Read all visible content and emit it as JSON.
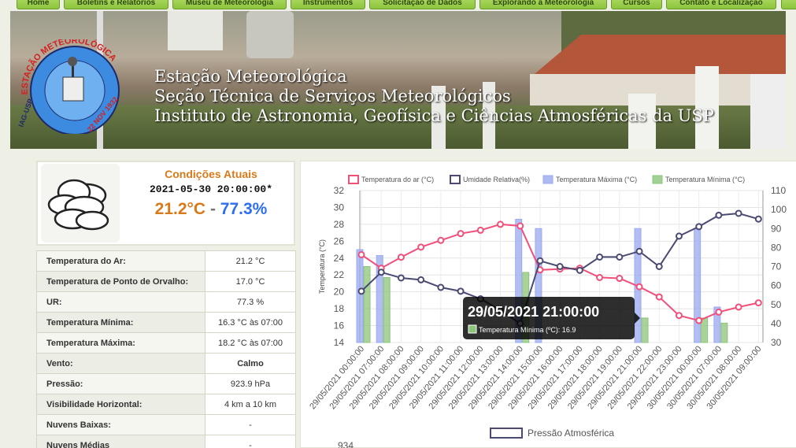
{
  "nav": {
    "items": [
      "Home",
      "Boletins e Relatórios",
      "Museu de Meteorologia",
      "Instrumentos",
      "Solicitação de Dados",
      "Explorando a Meteorologia",
      "Cursos",
      "Contato e Localização"
    ]
  },
  "banner": {
    "line1": "Estação Meteorológica",
    "line2": "Seção Técnica de Serviços Meteorológicos",
    "line3": "Instituto de Astronomia, Geofísica e Ciências Atmosféricas da USP",
    "logo_text_top": "ESTAÇÃO METEOROLÓGICA",
    "logo_text_left": "IAG-USP",
    "logo_text_bottom": "22 NOV 1932"
  },
  "current": {
    "title": "Condições Atuais",
    "timestamp": "2021-05-30 20:00:00*",
    "temperature": "21.2°C",
    "separator": "-",
    "humidity": "77.3%",
    "icon": "cloudy-icon"
  },
  "table": [
    {
      "label": "Temperatura do Ar:",
      "value": "21.2 °C"
    },
    {
      "label": "Temperatura de Ponto de Orvalho:",
      "value": "17.0 °C"
    },
    {
      "label": "UR:",
      "value": "77.3 %"
    },
    {
      "label": "Temperatura Mínima:",
      "value": "16.3 °C às 07:00"
    },
    {
      "label": "Temperatura Máxima:",
      "value": "18.2 °C às 07:00"
    },
    {
      "label": "Vento:",
      "value": "Calmo"
    },
    {
      "label": "Pressão:",
      "value": "923.9 hPa"
    },
    {
      "label": "Visibilidade Horizontal:",
      "value": "4 km a 10 km"
    },
    {
      "label": "Nuvens Baixas:",
      "value": "-"
    },
    {
      "label": "Nuvens Médias",
      "value": "-"
    }
  ],
  "colors": {
    "temp": "#f0507a",
    "humidity": "#4a4a72",
    "tmax": "#9aaaf0",
    "tmin": "#8cc47a"
  },
  "chart_data": [
    {
      "type": "line",
      "legend": [
        "Temperatura do ar (°C)",
        "Umidade Relativa(%)",
        "Temperatura Máxima (°C)",
        "Temperatura Mínima (°C)"
      ],
      "ylabel_left": "Temperatura (°C)",
      "ylim_left": [
        14,
        32
      ],
      "yticks_left": [
        14,
        16,
        18,
        20,
        22,
        24,
        26,
        28,
        30,
        32
      ],
      "ylim_right": [
        30,
        110
      ],
      "yticks_right": [
        30,
        40,
        50,
        60,
        70,
        80,
        90,
        100,
        110
      ],
      "categories": [
        "29/05/2021 00:00:00",
        "29/05/2021 07:00:00",
        "29/05/2021 08:00:00",
        "29/05/2021 09:00:00",
        "29/05/2021 10:00:00",
        "29/05/2021 11:00:00",
        "29/05/2021 12:00:00",
        "29/05/2021 13:00:00",
        "29/05/2021 14:00:00",
        "29/05/2021 15:00:00",
        "29/05/2021 16:00:00",
        "29/05/2021 17:00:00",
        "29/05/2021 18:00:00",
        "29/05/2021 19:00:00",
        "29/05/2021 21:00:00",
        "29/05/2021 22:00:00",
        "29/05/2021 23:00:00",
        "30/05/2021 00:00:00",
        "30/05/2021 07:00:00",
        "30/05/2021 08:00:00",
        "30/05/2021 09:00:00"
      ],
      "series": [
        {
          "name": "Temperatura do ar (°C)",
          "axis": "left",
          "kind": "line",
          "values": [
            24.4,
            22.8,
            24.1,
            25.3,
            26.1,
            26.9,
            27.3,
            28.0,
            27.8,
            22.6,
            22.7,
            22.8,
            21.7,
            21.6,
            20.6,
            19.4,
            17.2,
            16.6,
            17.6,
            18.2,
            18.7
          ]
        },
        {
          "name": "Umidade Relativa(%)",
          "axis": "right",
          "kind": "line",
          "values": [
            57,
            67,
            64,
            63,
            59,
            57,
            53,
            47,
            40,
            73,
            70,
            68,
            75,
            75,
            78,
            70,
            86,
            91,
            97,
            98,
            95
          ]
        },
        {
          "name": "Temperatura Máxima (°C)",
          "axis": "left",
          "kind": "bar",
          "values": [
            25.0,
            24.3,
            null,
            null,
            null,
            null,
            null,
            null,
            28.6,
            27.5,
            null,
            null,
            null,
            null,
            27.5,
            null,
            null,
            27.5,
            18.2,
            null,
            null
          ]
        },
        {
          "name": "Temperatura Mínima (°C)",
          "axis": "left",
          "kind": "bar",
          "values": [
            23.0,
            21.7,
            null,
            null,
            null,
            null,
            null,
            null,
            22.3,
            null,
            null,
            null,
            null,
            null,
            16.9,
            null,
            null,
            16.9,
            16.3,
            null,
            null
          ]
        }
      ],
      "tooltip": {
        "title": "29/05/2021 21:00:00",
        "label": "Temperatura Mínima (ºC): 16.9"
      }
    },
    {
      "type": "line",
      "legend": [
        "Pressão Atmosférica"
      ],
      "first_tick": "934"
    }
  ]
}
